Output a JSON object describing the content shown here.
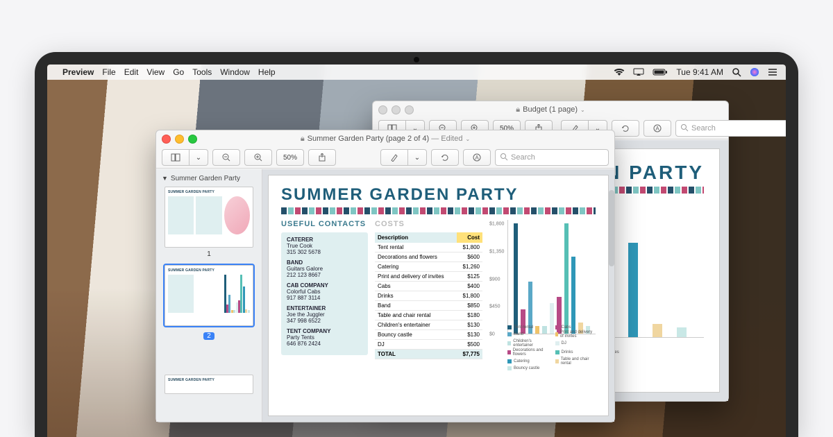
{
  "menubar": {
    "app": "Preview",
    "items": [
      "File",
      "Edit",
      "View",
      "Go",
      "Tools",
      "Window",
      "Help"
    ],
    "clock": "Tue 9:41 AM"
  },
  "back_window": {
    "title": "Budget (1 page)",
    "zoom_label": "50%",
    "search_placeholder": "Search"
  },
  "front_window": {
    "title": "Summer Garden Party (page 2 of 4)",
    "edited": "Edited",
    "zoom_label": "50%",
    "search_placeholder": "Search",
    "sidebar_title": "Summer Garden Party",
    "thumbs": [
      {
        "num": "1",
        "selected": false
      },
      {
        "num": "2",
        "selected": true
      }
    ]
  },
  "doc": {
    "title": "SUMMER GARDEN PARTY",
    "contacts_head": "USEFUL CONTACTS",
    "costs_head": "COSTS",
    "contacts": [
      {
        "label": "CATERER",
        "name": "True Cook",
        "phone": "315 302 5678"
      },
      {
        "label": "BAND",
        "name": "Guitars Galore",
        "phone": "212 123 8667"
      },
      {
        "label": "CAB COMPANY",
        "name": "Colorful Cabs",
        "phone": "917 887 3114"
      },
      {
        "label": "ENTERTAINER",
        "name": "Joe the Juggler",
        "phone": "347 998 6522"
      },
      {
        "label": "TENT COMPANY",
        "name": "Party Tents",
        "phone": "646 876 2424"
      }
    ],
    "cost_headers": {
      "desc": "Description",
      "cost": "Cost"
    },
    "costs": [
      {
        "desc": "Tent rental",
        "cost": "$1,800"
      },
      {
        "desc": "Decorations and flowers",
        "cost": "$600"
      },
      {
        "desc": "Catering",
        "cost": "$1,260"
      },
      {
        "desc": "Print and delivery of invites",
        "cost": "$125"
      },
      {
        "desc": "Cabs",
        "cost": "$400"
      },
      {
        "desc": "Drinks",
        "cost": "$1,800"
      },
      {
        "desc": "Band",
        "cost": "$850"
      },
      {
        "desc": "Table and chair rental",
        "cost": "$180"
      },
      {
        "desc": "Children's entertainer",
        "cost": "$130"
      },
      {
        "desc": "Bouncy castle",
        "cost": "$130"
      },
      {
        "desc": "DJ",
        "cost": "$500"
      }
    ],
    "total_label": "TOTAL",
    "total_value": "$7,775"
  },
  "chart_data": {
    "type": "bar",
    "title": "",
    "xlabel": "",
    "ylabel": "",
    "ylim": [
      0,
      1800
    ],
    "yticks": [
      0,
      450,
      900,
      1350,
      1800
    ],
    "yticks_display": [
      "$0",
      "$450",
      "$900",
      "$1,350",
      "$1,800"
    ],
    "series": [
      {
        "name": "Tent rental",
        "value": 1800,
        "color": "#1f5e7a"
      },
      {
        "name": "Cabs",
        "value": 400,
        "color": "#b74a86"
      },
      {
        "name": "Band",
        "value": 850,
        "color": "#5aa8c7"
      },
      {
        "name": "Print and delivery of invites",
        "value": 125,
        "color": "#efc36a"
      },
      {
        "name": "Children's entertainer",
        "value": 130,
        "color": "#bfe2e1"
      },
      {
        "name": "DJ",
        "value": 500,
        "color": "#dfeff0"
      },
      {
        "name": "Decorations and flowers",
        "value": 600,
        "color": "#b74a86"
      },
      {
        "name": "Drinks",
        "value": 1800,
        "color": "#56bfb5"
      },
      {
        "name": "Catering",
        "value": 1260,
        "color": "#2f97b8"
      },
      {
        "name": "Table and chair rental",
        "value": 180,
        "color": "#f0d6a0"
      },
      {
        "name": "Bouncy castle",
        "value": 130,
        "color": "#c9e8e6"
      }
    ]
  },
  "title_lock_icon": "lock-icon",
  "disclosure_icon": "chevron-down-icon",
  "toolbar_icons": {
    "sidebar": "sidebar-icon",
    "zoom_out": "zoom-out-icon",
    "zoom_in": "zoom-in-icon",
    "share": "share-icon",
    "highlight": "highlight-icon",
    "rotate": "rotate-icon",
    "markup": "markup-icon",
    "search": "search-icon"
  }
}
